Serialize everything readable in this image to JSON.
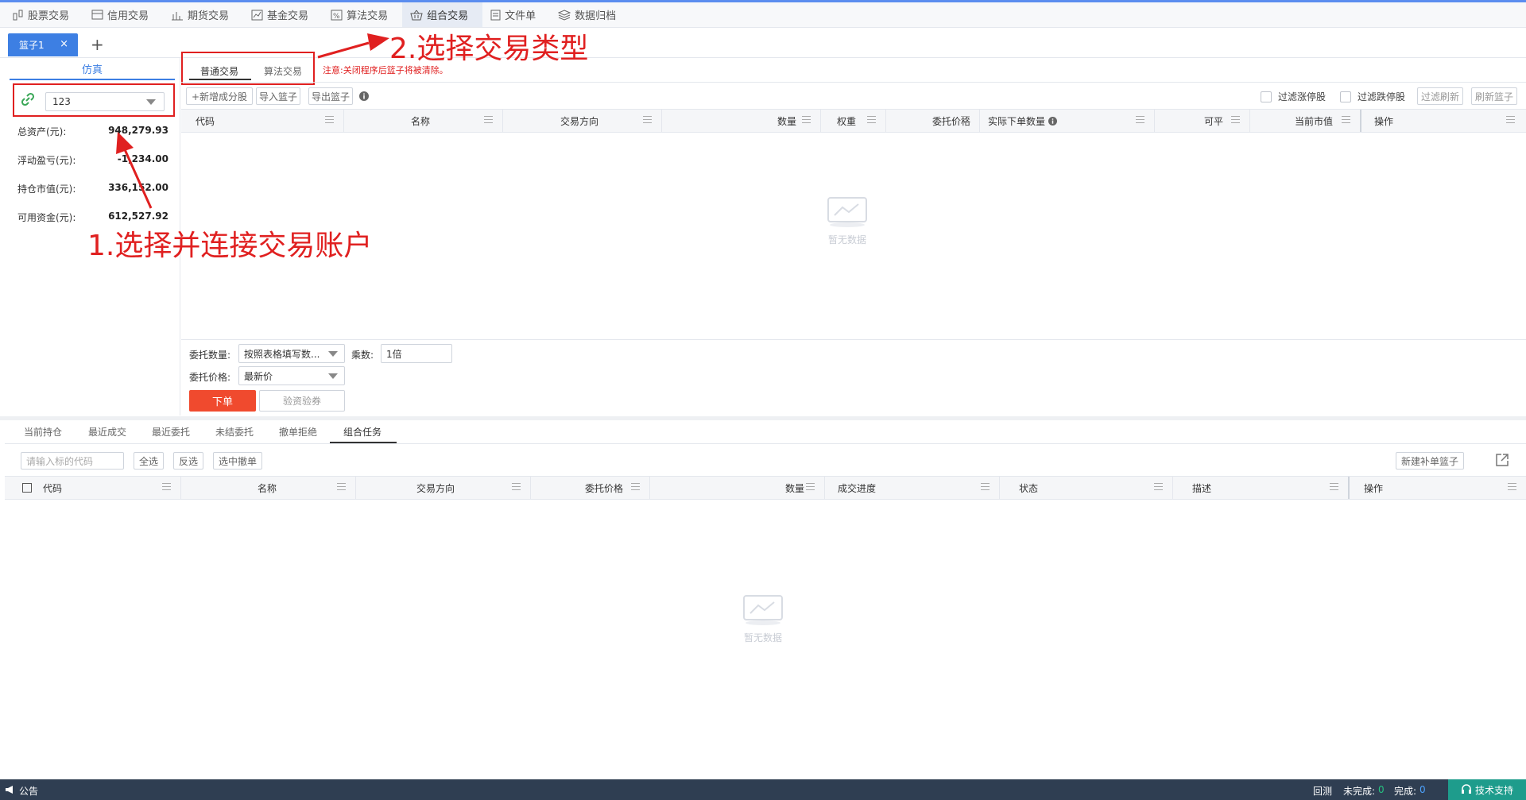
{
  "nav": {
    "items": [
      {
        "label": "股票交易",
        "icon": "stock-icon",
        "active": false
      },
      {
        "label": "信用交易",
        "icon": "credit-card-icon",
        "active": false
      },
      {
        "label": "期货交易",
        "icon": "futures-chart-icon",
        "active": false
      },
      {
        "label": "基金交易",
        "icon": "fund-chart-icon",
        "active": false
      },
      {
        "label": "算法交易",
        "icon": "algorithm-icon",
        "active": false
      },
      {
        "label": "组合交易",
        "icon": "basket-icon",
        "active": true
      },
      {
        "label": "文件单",
        "icon": "file-icon",
        "active": false
      },
      {
        "label": "数据归档",
        "icon": "layers-icon",
        "active": false
      }
    ]
  },
  "basket": {
    "tab_label": "篮子1",
    "close": "×",
    "add": "+"
  },
  "left": {
    "title": "仿真",
    "account_value": "123",
    "stats": [
      {
        "label": "总资产(元):",
        "value": "948,279.93"
      },
      {
        "label": "浮动盈亏(元):",
        "value": "-1,234.00"
      },
      {
        "label": "持仓市值(元):",
        "value": "336,152.00"
      },
      {
        "label": "可用资金(元):",
        "value": "612,527.92"
      }
    ]
  },
  "trade_type": {
    "tabs": [
      "普通交易",
      "算法交易"
    ],
    "notice": "注意:关闭程序后篮子将被清除。"
  },
  "toolbar": {
    "add_component": "+新增成分股",
    "import_basket": "导入篮子",
    "export_basket": "导出篮子",
    "filter_limit_up": "过滤涨停股",
    "filter_limit_down": "过滤跌停股",
    "filter_refresh": "过滤刷新",
    "refresh_basket": "刷新篮子"
  },
  "grid": {
    "columns": [
      "代码",
      "名称",
      "交易方向",
      "数量",
      "权重",
      "委托价格",
      "实际下单数量",
      "可平",
      "当前市值",
      "操作"
    ],
    "empty_text": "暂无数据"
  },
  "order_form": {
    "qty_label": "委托数量:",
    "qty_value": "按照表格填写数...",
    "multiplier_label": "乘数:",
    "multiplier_value": "1倍",
    "price_label": "委托价格:",
    "price_value": "最新价",
    "submit": "下单",
    "verify": "验资验券"
  },
  "bottom": {
    "tabs": [
      "当前持仓",
      "最近成交",
      "最近委托",
      "未结委托",
      "撤单拒绝",
      "组合任务"
    ],
    "active_tab": "组合任务",
    "search_placeholder": "请输入标的代码",
    "select_all": "全选",
    "invert": "反选",
    "cancel_selected": "选中撤单",
    "new_supplement": "新建补单篮子",
    "columns": [
      "代码",
      "名称",
      "交易方向",
      "委托价格",
      "数量",
      "成交进度",
      "状态",
      "描述",
      "操作"
    ],
    "empty_text": "暂无数据"
  },
  "status": {
    "notice": "公告",
    "backtest": "回测",
    "unfinished_label": "未完成:",
    "unfinished_value": "0",
    "finished_label": "完成:",
    "finished_value": "0",
    "support": "技术支持"
  },
  "annotations": {
    "step1": "1.选择并连接交易账户",
    "step2": "2.选择交易类型"
  },
  "colors": {
    "accent": "#3d7fe3",
    "danger": "#e02020",
    "order_button": "#f04a2e",
    "statusbar": "#2f3e52",
    "support": "#1e9c8c"
  }
}
